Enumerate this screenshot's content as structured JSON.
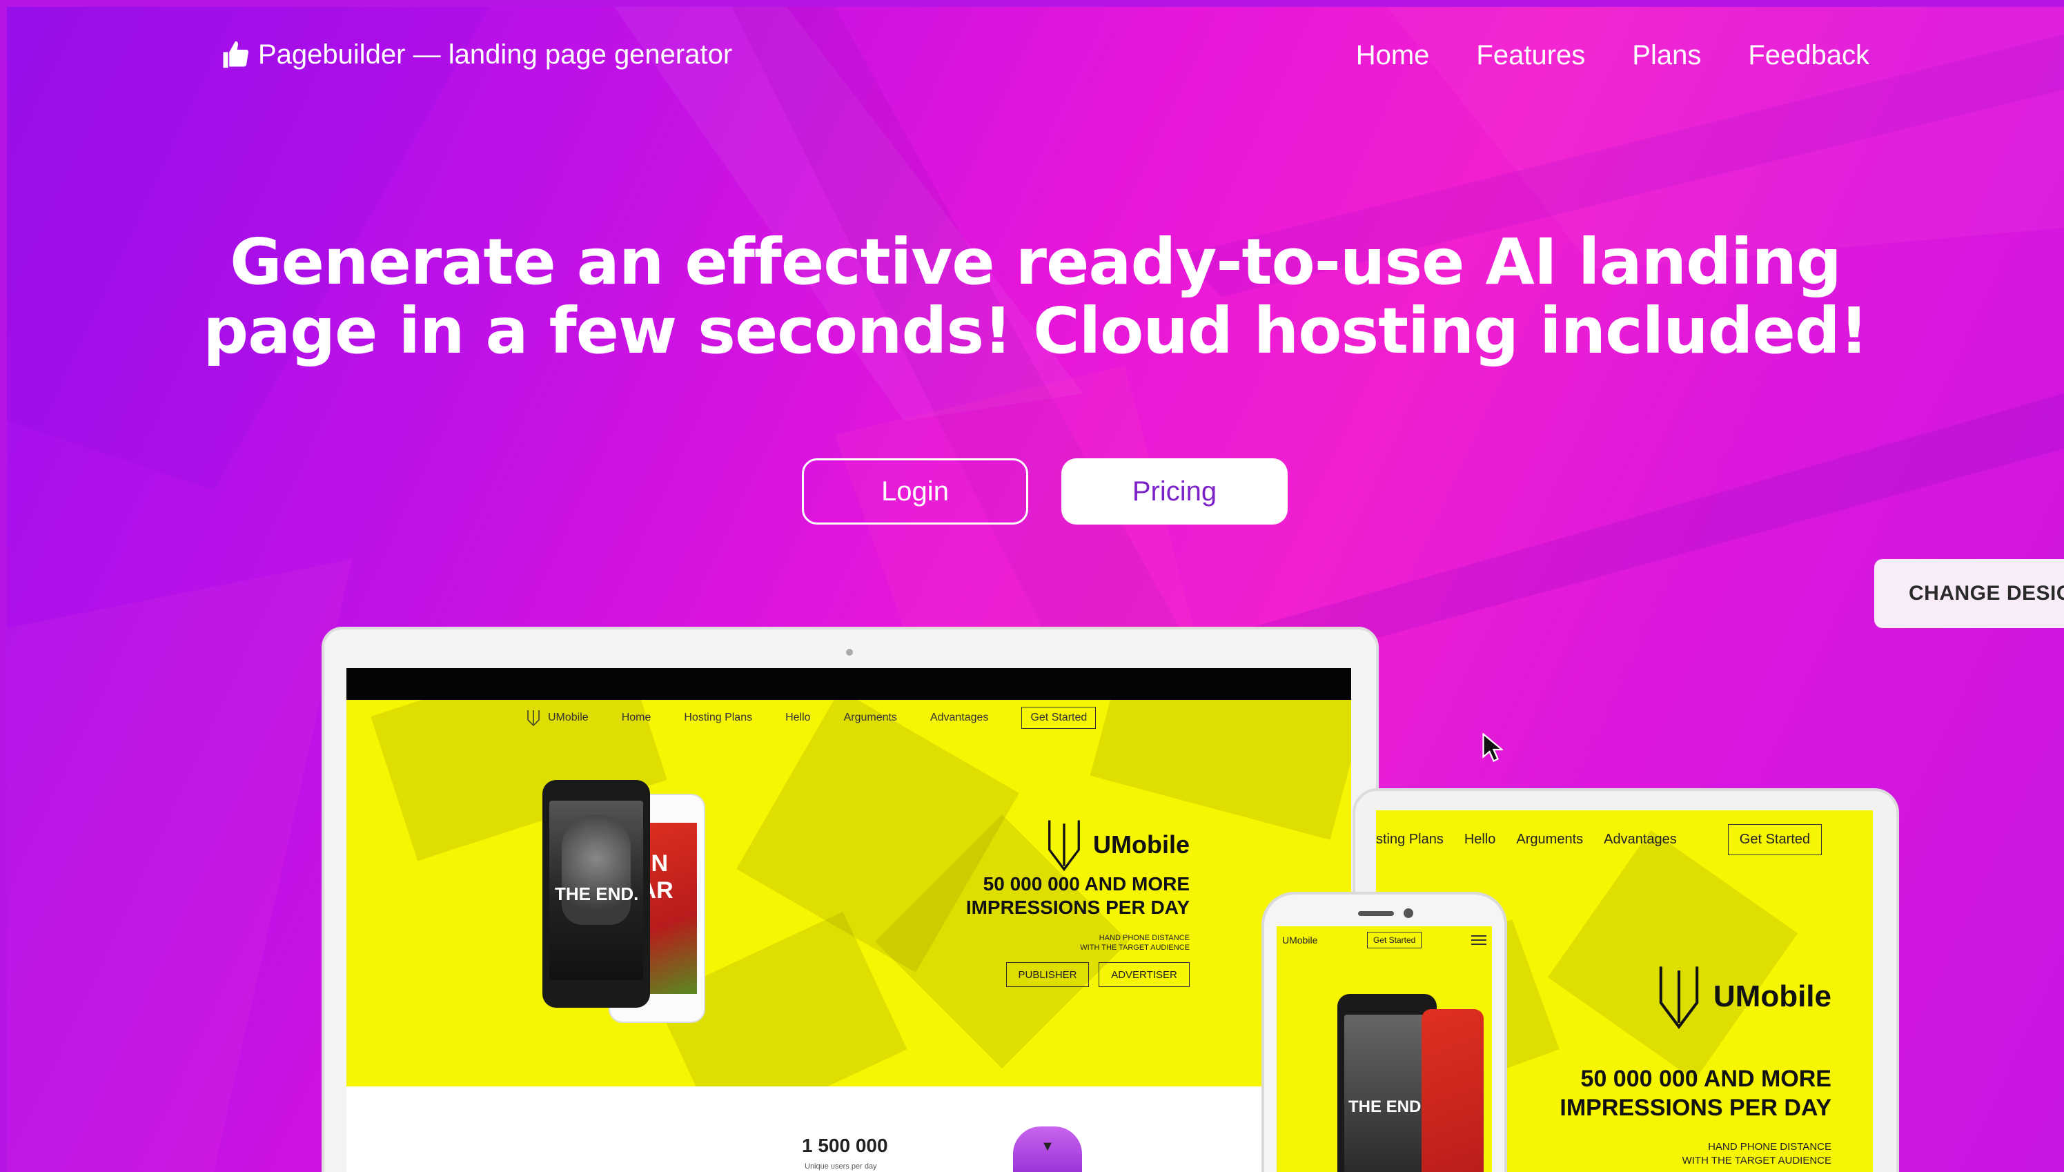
{
  "header": {
    "brand": "Pagebuilder — landing page generator",
    "nav": [
      "Home",
      "Features",
      "Plans",
      "Feedback"
    ]
  },
  "hero": {
    "title_line1": "Generate an effective ready-to-use AI landing",
    "title_line2": "page in a few seconds! Cloud hosting included!",
    "login_label": "Login",
    "pricing_label": "Pricing"
  },
  "side": {
    "change_design": "CHANGE DESIGN"
  },
  "preview": {
    "nav": {
      "logo": "UMobile",
      "items": [
        "Home",
        "Hosting Plans",
        "Hello",
        "Arguments",
        "Advantages"
      ],
      "cta": "Get Started"
    },
    "brand": "UMobile",
    "headline_line1": "50 000 000 AND MORE",
    "headline_line2": "IMPRESSIONS PER DAY",
    "sub_line1": "HAND PHONE DISTANCE",
    "sub_line2": "WITH THE TARGET AUDIENCE",
    "publisher": "PUBLISHER",
    "advertiser": "ADVERTISER",
    "stat_value": "1 500 000",
    "stat_label": "Unique users per day",
    "poster_left": "THE END.",
    "poster_right": "WIN CAR",
    "tablet_nav": [
      "sting Plans",
      "Hello",
      "Arguments",
      "Advantages"
    ],
    "phone_logo": "UMobile",
    "phone_cta": "Get Started"
  },
  "colors": {
    "accent_yellow": "#f6f602",
    "pricing_text": "#7b22c9"
  }
}
